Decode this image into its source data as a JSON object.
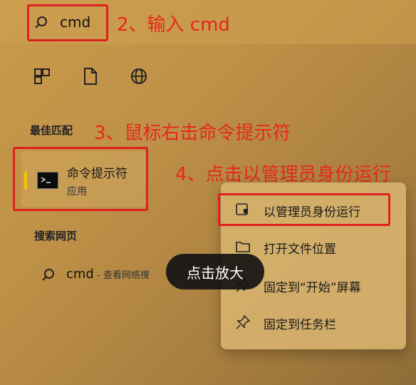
{
  "search": {
    "query": "cmd"
  },
  "annotations": {
    "step2": "2、输入 cmd",
    "step3": "3、鼠标右击命令提示符",
    "step4": "4、点击以管理员身份运行"
  },
  "quick_icons": [
    "apps-icon",
    "document-icon",
    "globe-icon"
  ],
  "best_match": {
    "header": "最佳匹配",
    "title": "命令提示符",
    "subtitle": "应用"
  },
  "web_search": {
    "header": "搜索网页",
    "query": "cmd",
    "suffix": " - 查看网络搜"
  },
  "context_menu": {
    "items": [
      {
        "label": "以管理员身份运行",
        "icon": "shield-icon"
      },
      {
        "label": "打开文件位置",
        "icon": "folder-icon"
      },
      {
        "label": "固定到“开始”屏幕",
        "icon": "pin-icon"
      },
      {
        "label": "固定到任务栏",
        "icon": "pin-icon"
      }
    ]
  },
  "zoom_hint": "点击放大",
  "colors": {
    "annotation": "#e8271c",
    "accent": "#f5c400"
  }
}
